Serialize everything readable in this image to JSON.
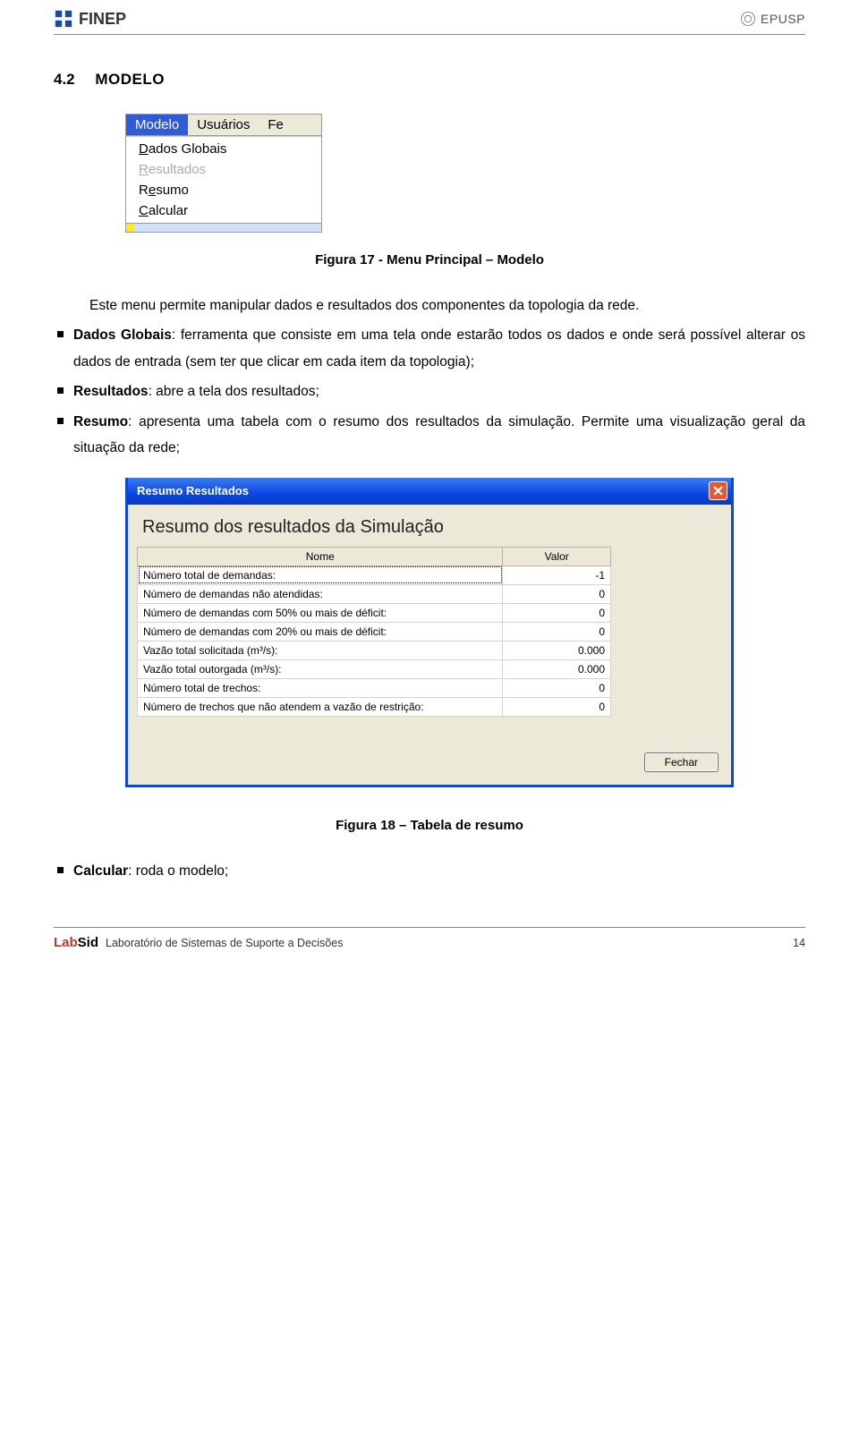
{
  "header": {
    "logo_left": "FINEP",
    "logo_right": "EPUSP"
  },
  "section": {
    "number": "4.2",
    "title": "MODELO"
  },
  "menu_snippet": {
    "menubar": [
      {
        "label": "Modelo",
        "active": true
      },
      {
        "label": "Usuários",
        "active": false
      },
      {
        "label": "Fe",
        "active": false
      }
    ],
    "dropdown": [
      {
        "label_pre": "",
        "underline": "D",
        "label_post": "ados Globais",
        "disabled": false
      },
      {
        "label_pre": "",
        "underline": "R",
        "label_post": "esultados",
        "disabled": true
      },
      {
        "label_pre": "R",
        "underline": "e",
        "label_post": "sumo",
        "disabled": false
      },
      {
        "label_pre": "",
        "underline": "C",
        "label_post": "alcular",
        "disabled": false
      }
    ]
  },
  "fig17_caption": "Figura 17 - Menu Principal – Modelo",
  "intro_para": "Este menu permite manipular dados e resultados dos componentes da topologia da rede.",
  "bullets_top": [
    {
      "lead": "Dados Globais",
      "rest": ": ferramenta que consiste em uma tela onde estarão todos os dados e onde será possível alterar os dados de entrada (sem ter que clicar em cada item da topologia);"
    },
    {
      "lead": "Resultados",
      "rest": ": abre a tela dos resultados;"
    },
    {
      "lead": "Resumo",
      "rest": ": apresenta uma tabela com o resumo dos resultados da simulação. Permite uma visualização geral da situação da rede;"
    }
  ],
  "dialog": {
    "title": "Resumo Resultados",
    "heading": "Resumo dos resultados da Simulação",
    "columns": {
      "c1": "Nome",
      "c2": "Valor"
    },
    "rows": [
      {
        "name": "Número total de demandas:",
        "value": "-1",
        "selected": true
      },
      {
        "name": "Número de demandas não atendidas:",
        "value": "0"
      },
      {
        "name": "Número de demandas com 50% ou mais de déficit:",
        "value": "0"
      },
      {
        "name": "Número de demandas com 20% ou mais de déficit:",
        "value": "0"
      },
      {
        "name": "Vazão total solicitada (m³/s):",
        "value": "0.000"
      },
      {
        "name": "Vazão total outorgada (m³/s):",
        "value": "0.000"
      },
      {
        "name": "Número total de trechos:",
        "value": "0"
      },
      {
        "name": "Número de trechos que não atendem a vazão de restrição:",
        "value": "0"
      }
    ],
    "close_button": "Fechar"
  },
  "fig18_caption": "Figura 18 – Tabela de resumo",
  "bullets_bottom": [
    {
      "lead": "Calcular",
      "rest": ": roda o modelo;"
    }
  ],
  "footer": {
    "labsid_a": "Lab",
    "labsid_b": "Sid",
    "lab_name": "Laboratório de Sistemas de Suporte a Decisões",
    "page_number": "14"
  }
}
